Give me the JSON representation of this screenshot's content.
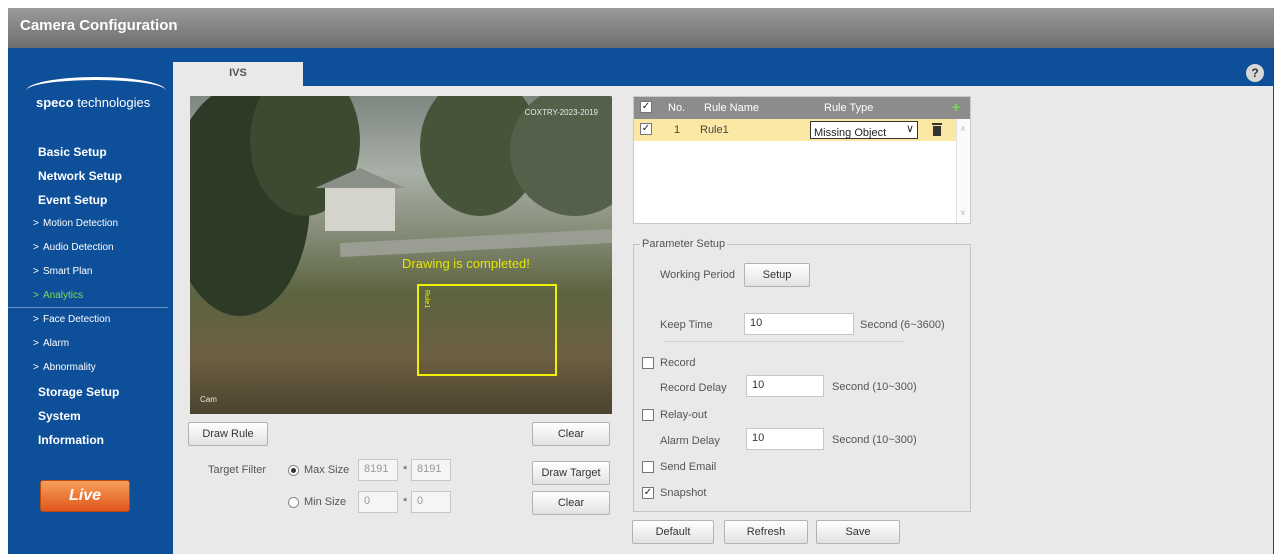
{
  "window": {
    "title": "Camera Configuration"
  },
  "brand": {
    "name_bold": "speco",
    "name_rest": " technologies"
  },
  "sidebar": {
    "items": [
      {
        "label": "Basic Setup",
        "kind": "main"
      },
      {
        "label": "Network Setup",
        "kind": "main"
      },
      {
        "label": "Event Setup",
        "kind": "main"
      },
      {
        "label": "Motion Detection",
        "kind": "sub"
      },
      {
        "label": "Audio Detection",
        "kind": "sub"
      },
      {
        "label": "Smart Plan",
        "kind": "sub"
      },
      {
        "label": "Analytics",
        "kind": "sub",
        "active": true
      },
      {
        "label": "Face Detection",
        "kind": "sub"
      },
      {
        "label": "Alarm",
        "kind": "sub"
      },
      {
        "label": "Abnormality",
        "kind": "sub"
      },
      {
        "label": "Storage Setup",
        "kind": "main"
      },
      {
        "label": "System",
        "kind": "main"
      },
      {
        "label": "Information",
        "kind": "main"
      }
    ],
    "chevron": ">",
    "live_label": "Live"
  },
  "help": {
    "icon": "help-icon",
    "glyph": "?"
  },
  "tab": {
    "label": "IVS"
  },
  "video": {
    "stamp": "COXTRY-2023-2019",
    "label": "Cam",
    "status": "Drawing is completed!",
    "rule_tag": "Rule1"
  },
  "video_controls": {
    "draw_rule": "Draw Rule",
    "clear_top": "Clear",
    "target_filter_label": "Target Filter",
    "max_size_label": "Max Size",
    "max_w": "8191",
    "max_h": "8191",
    "min_size_label": "Min Size",
    "min_w": "0",
    "min_h": "0",
    "times": "*",
    "draw_target": "Draw Target",
    "clear_bottom": "Clear"
  },
  "rules": {
    "headers": {
      "no": "No.",
      "name": "Rule Name",
      "type": "Rule Type"
    },
    "rows": [
      {
        "checked": true,
        "no": "1",
        "name": "Rule1",
        "type": "Missing Object"
      }
    ]
  },
  "params": {
    "title": "Parameter Setup",
    "working_period_label": "Working Period",
    "setup_button": "Setup",
    "keep_time_label": "Keep Time",
    "keep_time_value": "10",
    "keep_time_unit": "Second (6~3600)",
    "record_label": "Record",
    "record_checked": false,
    "record_delay_label": "Record Delay",
    "record_delay_value": "10",
    "record_delay_unit": "Second (10~300)",
    "relay_out_label": "Relay-out",
    "relay_out_checked": false,
    "alarm_delay_label": "Alarm Delay",
    "alarm_delay_value": "10",
    "alarm_delay_unit": "Second (10~300)",
    "send_email_label": "Send Email",
    "send_email_checked": false,
    "snapshot_label": "Snapshot",
    "snapshot_checked": true
  },
  "footer_buttons": {
    "default": "Default",
    "refresh": "Refresh",
    "save": "Save"
  },
  "check_glyph": "✓"
}
